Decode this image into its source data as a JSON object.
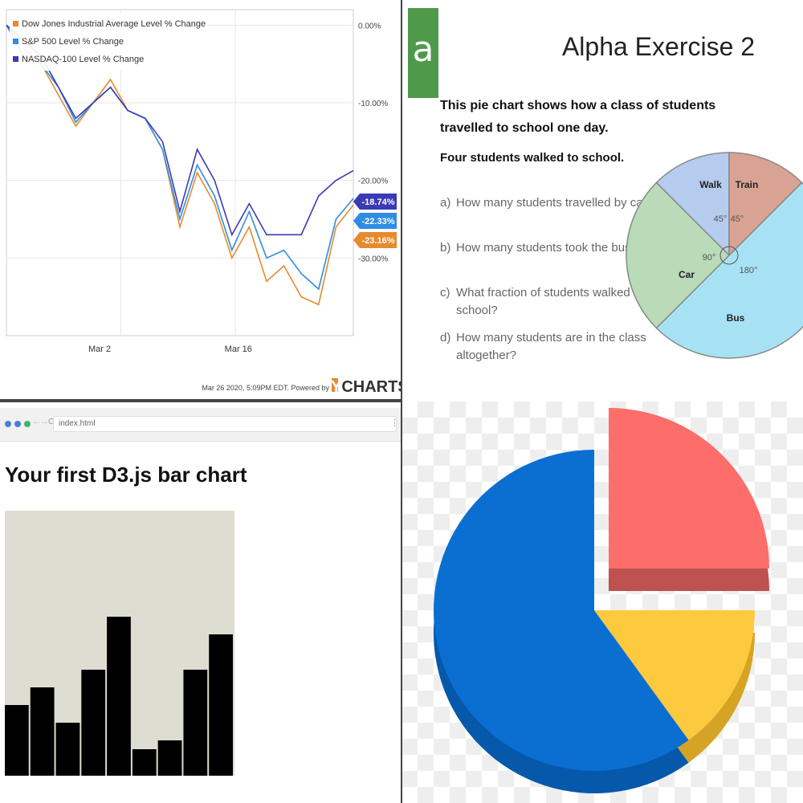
{
  "chart_data": [
    {
      "type": "line",
      "legend": [
        "Dow Jones Industrial Average Level % Change",
        "S&P 500 Level % Change",
        "NASDAQ-100 Level % Change"
      ],
      "series": [
        {
          "name": "Dow Jones Industrial Average Level % Change",
          "color": "#e68a2e",
          "values": [
            0,
            -3,
            -5,
            -9,
            -13,
            -10,
            -7,
            -11,
            -12,
            -16,
            -26,
            -19,
            -23,
            -30,
            -26,
            -33,
            -31,
            -35,
            -36,
            -26,
            -23.16
          ]
        },
        {
          "name": "S&P 500 Level % Change",
          "color": "#2f8de4",
          "values": [
            0,
            -4,
            -5,
            -8,
            -12.5,
            -10,
            -8,
            -11,
            -12,
            -16,
            -25,
            -18,
            -22,
            -29,
            -24,
            -30,
            -29,
            -32,
            -34,
            -25,
            -22.33
          ]
        },
        {
          "name": "NASDAQ-100 Level % Change",
          "color": "#3a3ab5",
          "values": [
            0,
            -2,
            -4,
            -8,
            -12,
            -10,
            -8,
            -11,
            -12,
            -15,
            -24,
            -16,
            -20,
            -27,
            -23,
            -27,
            -27,
            -27,
            -22,
            -20,
            -18.74
          ]
        }
      ],
      "y_ticks": [
        "0.00%",
        "-10.00%",
        "-20.00%",
        "-30.00%"
      ],
      "y_range": [
        -40,
        2
      ],
      "x_ticks": [
        "Mar 2",
        "Mar 16"
      ],
      "end_labels": [
        "-18.74%",
        "-22.33%",
        "-23.16%"
      ],
      "footer": "Mar 26 2020, 5:09PM EDT.  Powered by",
      "brand": "YCHARTS"
    },
    {
      "type": "pie",
      "labels": [
        "Walk",
        "Train",
        "Bus",
        "Car"
      ],
      "values": [
        45,
        45,
        180,
        90
      ],
      "angle_labels": [
        "45°",
        "45°",
        "180°",
        "90°"
      ],
      "colors": [
        "#b6ccee",
        "#d9a393",
        "#a7e2f4",
        "#b9dbb8"
      ]
    },
    {
      "type": "bar",
      "values": [
        4,
        5,
        3,
        6,
        9,
        1.5,
        2,
        6,
        8
      ],
      "ylim": [
        0,
        15
      ],
      "bar_color": "#000000",
      "background": "#ddddd1"
    },
    {
      "type": "pie",
      "values": [
        25,
        15,
        60
      ],
      "colors": [
        "#fd6e6a",
        "#fdc93f",
        "#0a6fd1"
      ],
      "shade_colors": [
        "#bd5250",
        "#d6a424",
        "#0658ab"
      ]
    }
  ],
  "exercise": {
    "logo": "a",
    "title": "Alpha Exercise 2",
    "intro": "This pie chart shows how a class of students travelled to school one day.",
    "given": "Four students walked to school.",
    "questions": [
      {
        "label": "a)",
        "text": "How many students travelled by car?"
      },
      {
        "label": "b)",
        "text": "How many students took the bus?"
      },
      {
        "label": "c)",
        "text": "What fraction of students walked to school?"
      },
      {
        "label": "d)",
        "text": "How many students are in the class altogether?"
      }
    ]
  },
  "browser": {
    "url": "index.html",
    "heading": "Your first D3.js bar chart",
    "nav_back": "←",
    "nav_forward": "→",
    "reload": "C",
    "menu": "⋮",
    "dot_colors": [
      "#4a7fd6",
      "#4a7fd6",
      "#44b36a"
    ]
  }
}
